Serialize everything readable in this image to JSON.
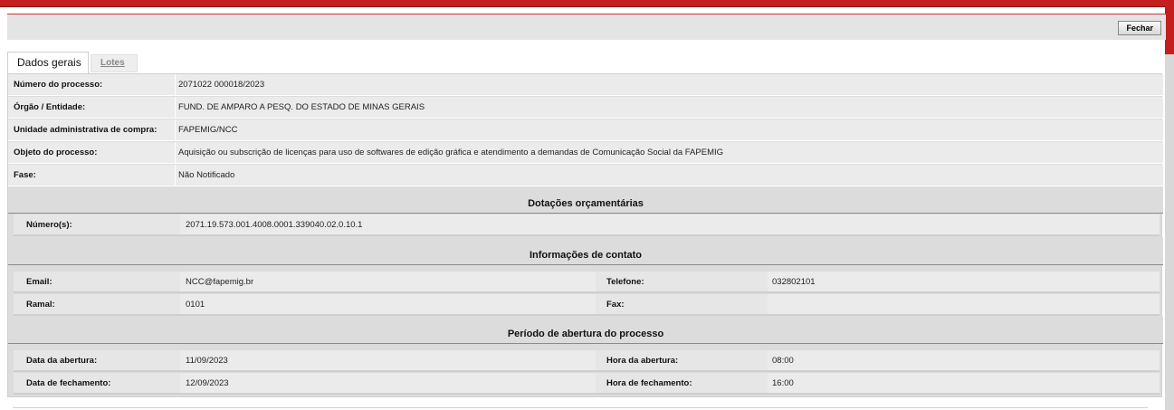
{
  "toolbar": {
    "close_label": "Fechar"
  },
  "tabs": [
    {
      "label": "Dados gerais"
    },
    {
      "label": "Lotes"
    }
  ],
  "general": [
    {
      "label": "Número do processo:",
      "value": "2071022 000018/2023"
    },
    {
      "label": "Órgão / Entidade:",
      "value": "FUND. DE AMPARO A PESQ. DO ESTADO DE MINAS GERAIS"
    },
    {
      "label": "Unidade administrativa de compra:",
      "value": "FAPEMIG/NCC"
    },
    {
      "label": "Objeto do processo:",
      "value": "Aquisição ou subscrição de licenças para uso de softwares de edição gráfica e atendimento a demandas de Comunicação Social da FAPEMIG"
    },
    {
      "label": "Fase:",
      "value": "Não Notificado"
    }
  ],
  "budget": {
    "title": "Dotações orçamentárias",
    "label": "Número(s):",
    "value": "2071.19.573.001.4008.0001.339040.02.0.10.1"
  },
  "contact": {
    "title": "Informações de contato",
    "email_label": "Email:",
    "email_value": "NCC@fapemig.br",
    "phone_label": "Telefone:",
    "phone_value": "032802101",
    "ramal_label": "Ramal:",
    "ramal_value": "0101",
    "fax_label": "Fax:",
    "fax_value": ""
  },
  "period": {
    "title": "Período de abertura do processo",
    "open_date_label": "Data da abertura:",
    "open_date_value": "11/09/2023",
    "open_time_label": "Hora da abertura:",
    "open_time_value": "08:00",
    "close_date_label": "Data de fechamento:",
    "close_date_value": "12/09/2023",
    "close_time_label": "Hora de fechamento:",
    "close_time_value": "16:00"
  }
}
